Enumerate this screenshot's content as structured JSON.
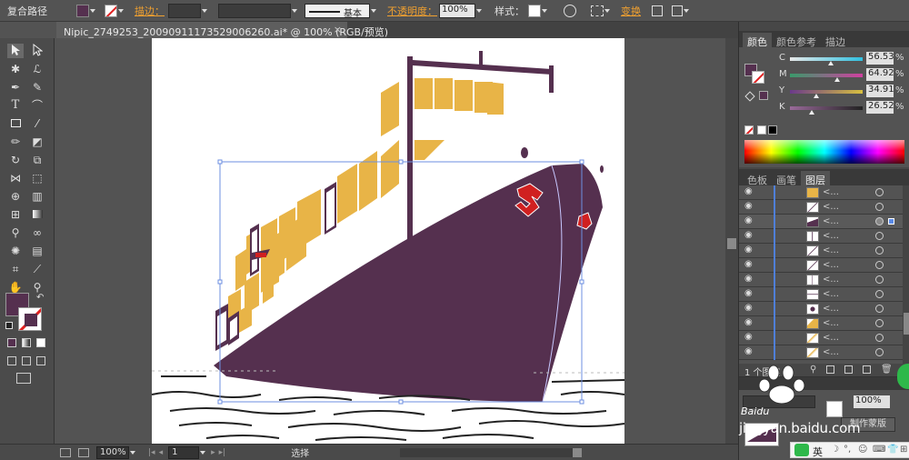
{
  "control": {
    "mode_label": "复合路径",
    "stroke_label": "描边：",
    "basic_label": "基本",
    "opacity_label": "不透明度：",
    "opacity_value": "100%",
    "style_label": "样式：",
    "transform_label": "变换"
  },
  "document": {
    "tab_title": "Nipic_2749253_20090911173529006260.ai* @ 100% (RGB/预览)",
    "close_glyph": "×"
  },
  "tools": {
    "type_glyph": "T"
  },
  "status": {
    "zoom": "100%",
    "artboard": "1",
    "tool_name": "选择"
  },
  "color_panel": {
    "tabs": [
      "颜色",
      "颜色参考",
      "描边"
    ],
    "channels": [
      {
        "letter": "C",
        "value": "56.53",
        "pct": "%",
        "color": "#30c0e0",
        "level": 0.57
      },
      {
        "letter": "M",
        "value": "64.92",
        "pct": "%",
        "color": "#d040a0",
        "level": 0.65
      },
      {
        "letter": "Y",
        "value": "34.91",
        "pct": "%",
        "color": "#d8c040",
        "level": 0.35
      },
      {
        "letter": "K",
        "value": "26.52",
        "pct": "%",
        "color": "#555555",
        "level": 0.27
      }
    ],
    "fill_color": "#55304f"
  },
  "layers_panel": {
    "tabs": [
      "色板",
      "画笔",
      "图层"
    ],
    "footer": "1 个图层"
  },
  "transparency_panel": {
    "opacity": "100%",
    "make_mask": "制作蒙版"
  },
  "watermark": {
    "brand": "Baidu",
    "site": "jingyan.baidu.com",
    "ime": "英"
  }
}
